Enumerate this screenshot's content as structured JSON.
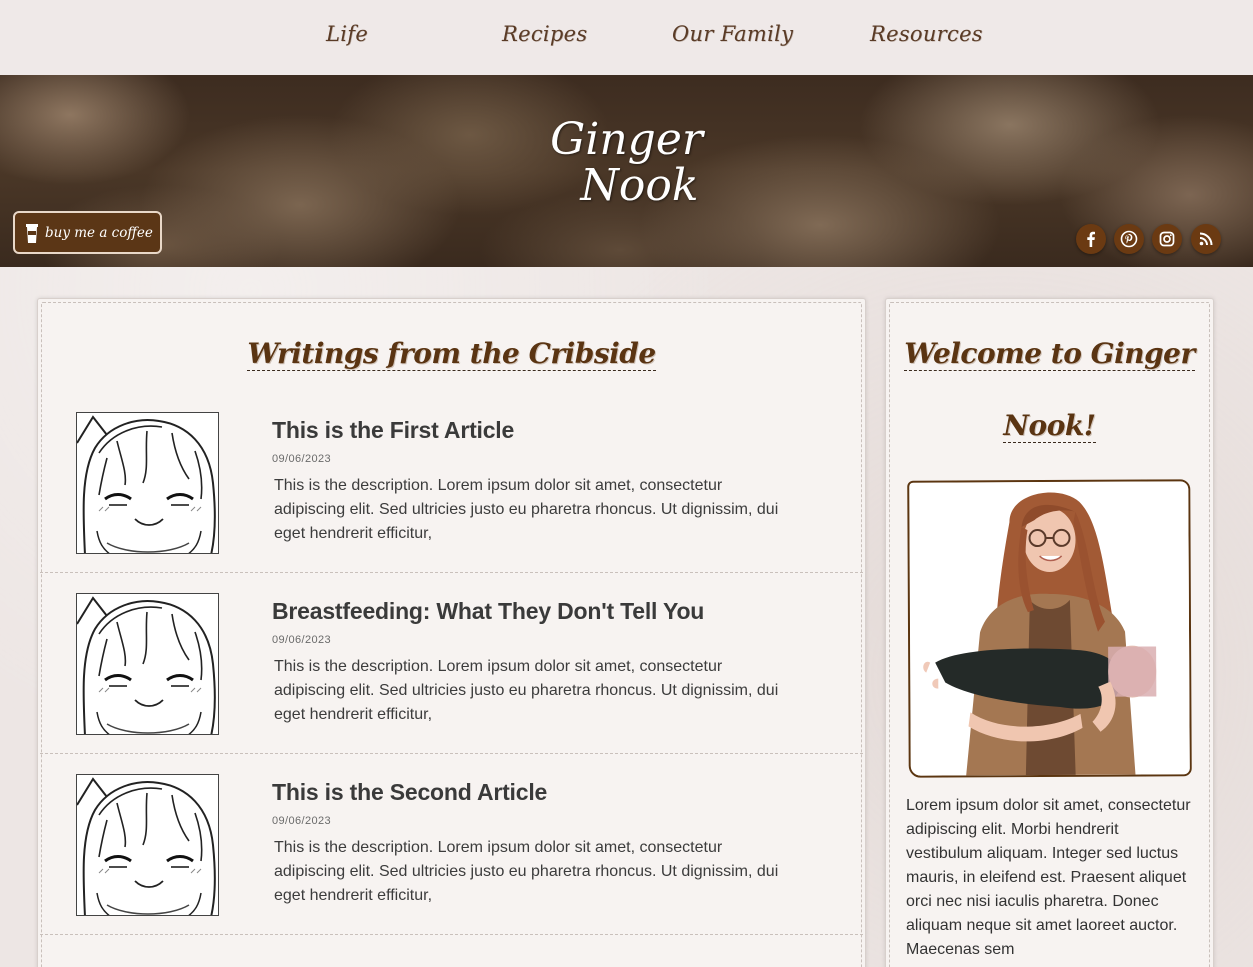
{
  "nav": {
    "items": [
      {
        "label": "Life"
      },
      {
        "label": "Recipes"
      },
      {
        "label": "Our Family"
      },
      {
        "label": "Resources"
      }
    ]
  },
  "hero": {
    "title_line1": "Ginger",
    "title_line2": "Nook",
    "coffee_label": "buy me a coffee",
    "social_icons": [
      "facebook-icon",
      "pinterest-icon",
      "instagram-icon",
      "rss-icon"
    ]
  },
  "main": {
    "title": "Writings from the Cribside",
    "articles": [
      {
        "title": "This is the First Article",
        "date": "09/06/2023",
        "description": "This is the description. Lorem ipsum dolor sit amet, consectetur adipiscing elit. Sed ultricies justo eu pharetra rhoncus. Ut dignissim, dui eget hendrerit efficitur,"
      },
      {
        "title": "Breastfeeding: What They Don't Tell You",
        "date": "09/06/2023",
        "description": "This is the description. Lorem ipsum dolor sit amet, consectetur adipiscing elit. Sed ultricies justo eu pharetra rhoncus. Ut dignissim, dui eget hendrerit efficitur,"
      },
      {
        "title": "This is the Second Article",
        "date": "09/06/2023",
        "description": "This is the description. Lorem ipsum dolor sit amet, consectetur adipiscing elit. Sed ultricies justo eu pharetra rhoncus. Ut dignissim, dui eget hendrerit efficitur,"
      }
    ]
  },
  "sidebar": {
    "title_line1": "Welcome to Ginger",
    "title_line2": "Nook!",
    "body": "Lorem ipsum dolor sit amet, consectetur adipiscing elit. Morbi hendrerit vestibulum aliquam. Integer sed luctus mauris, in eleifend est. Praesent aliquet orci nec nisi iaculis pharetra. Donec aliquam neque sit amet laoreet auctor. Maecenas sem"
  },
  "colors": {
    "accent_brown": "#5b3616",
    "nav_text": "#5a3b26",
    "page_bg": "#ede6e4",
    "card_bg": "#f7f3f1"
  }
}
